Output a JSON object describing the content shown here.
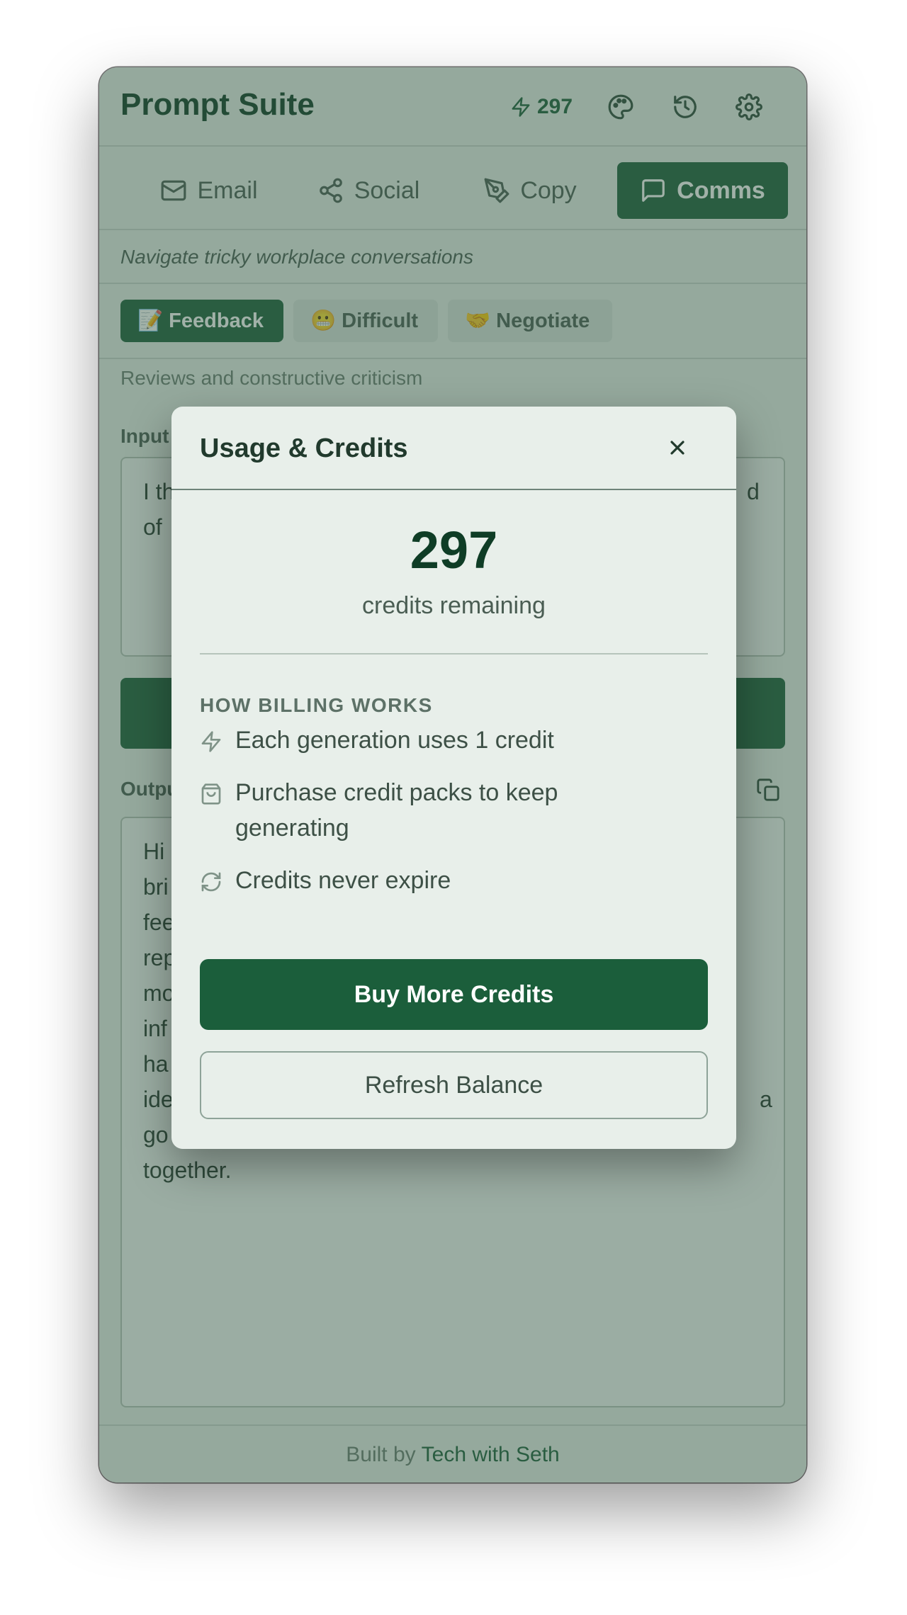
{
  "app": {
    "title": "Prompt Suite",
    "credits_badge": "297"
  },
  "header_icons": [
    "palette-icon",
    "history-icon",
    "gear-icon"
  ],
  "tabs": [
    {
      "label": "Email",
      "icon": "mail-icon"
    },
    {
      "label": "Social",
      "icon": "share-icon"
    },
    {
      "label": "Copy",
      "icon": "pen-tool-icon"
    },
    {
      "label": "Comms",
      "icon": "message-square-icon",
      "active": true
    }
  ],
  "section": {
    "subtitle": "Navigate tricky workplace conversations"
  },
  "chips": [
    {
      "label": "📝 Feedback",
      "active": true
    },
    {
      "label": "😬 Difficult"
    },
    {
      "label": "🤝 Negotiate"
    }
  ],
  "chip_description": "Reviews and constructive criticism",
  "input": {
    "label": "Input",
    "text_line1": "I th",
    "text_line1_end": "d",
    "text_line2": "of"
  },
  "output": {
    "label": "Output",
    "lines": [
      "Hi",
      "bri",
      "fee",
      "rep",
      "mo",
      "inf",
      "ha",
      "ide",
      "go",
      "together."
    ],
    "line_end": "a"
  },
  "modal": {
    "title": "Usage & Credits",
    "credits": "297",
    "credits_label": "credits remaining",
    "section_title": "HOW BILLING WORKS",
    "items": [
      {
        "text": "Each generation uses 1 credit",
        "icon": "zap-icon"
      },
      {
        "text": "Purchase credit packs to keep generating",
        "icon": "shopping-bag-icon"
      },
      {
        "text": "Credits never expire",
        "icon": "refresh-icon"
      }
    ],
    "buy_label": "Buy More Credits",
    "refresh_label": "Refresh Balance"
  },
  "footer": {
    "prefix": "Built by",
    "link": "Tech with Seth"
  },
  "colors": {
    "accent": "#1b5e3b",
    "background": "#e9efea",
    "overlay": "#3a5c4a"
  }
}
